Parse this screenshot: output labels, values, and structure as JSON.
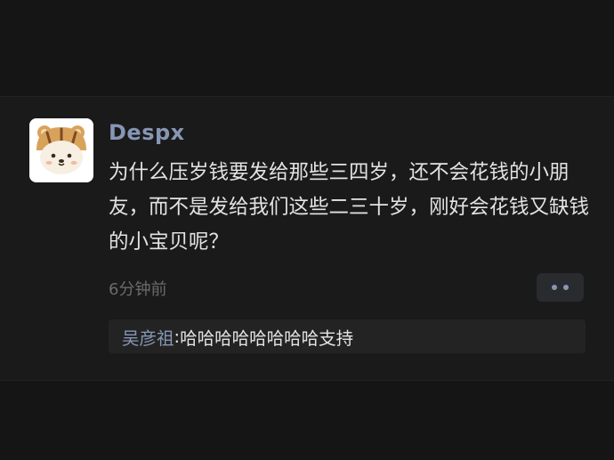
{
  "post": {
    "username": "Despx",
    "avatar_icon": "bear-hat-avatar-icon",
    "content": "为什么压岁钱要发给那些三四岁，还不会花钱的小朋友，而不是发给我们这些二三十岁，刚好会花钱又缺钱的小宝贝呢？",
    "timestamp": "6分钟前",
    "more_icon": "more-dots-icon"
  },
  "comment": {
    "author": "吴彦祖",
    "separator": ": ",
    "text": "哈哈哈哈哈哈哈哈支持"
  },
  "colors": {
    "background": "#151515",
    "card": "#1a1a1a",
    "username": "#8796b4",
    "text": "#e3e3e3",
    "muted": "#6b6b6b",
    "comment_bg": "#232323",
    "button_bg": "#2a2b2f"
  }
}
